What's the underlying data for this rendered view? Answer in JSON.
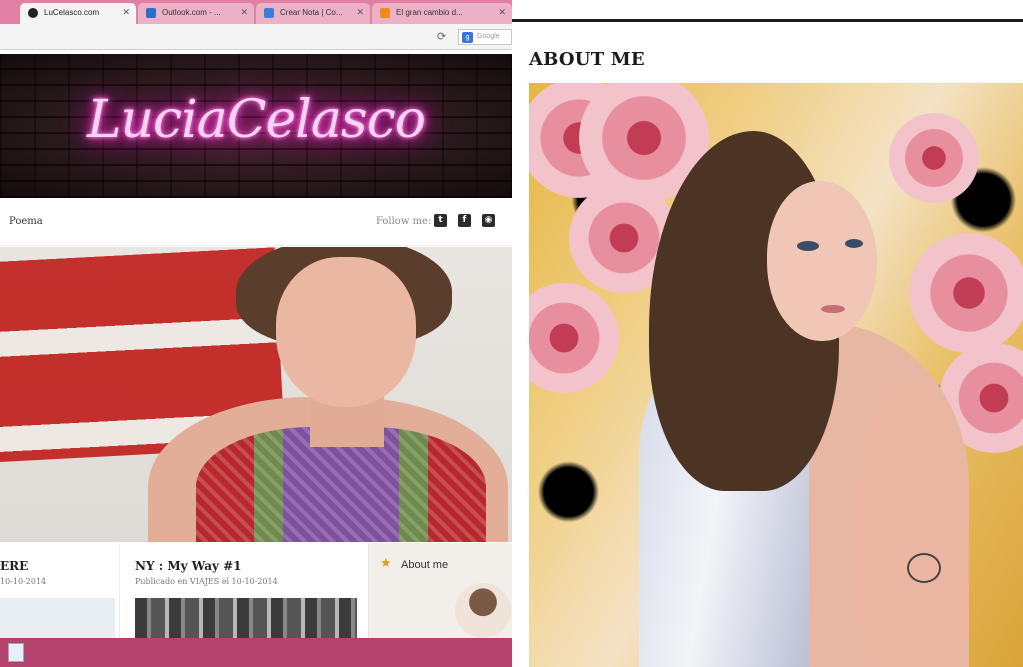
{
  "browser": {
    "tabs": [
      {
        "label": "LuCelasco.com",
        "active": true
      },
      {
        "label": "Outlook.com - ...",
        "active": false
      },
      {
        "label": "Crear Nota | Co...",
        "active": false
      },
      {
        "label": "El gran cambio d...",
        "active": false
      }
    ],
    "search_placeholder": "Google"
  },
  "site": {
    "logo_text": "LuciaCelasco",
    "nav": {
      "item": "Poema",
      "follow_label": "Follow me:"
    },
    "social_icons": [
      "instagram-icon",
      "facebook-icon",
      "tumblr-icon"
    ]
  },
  "posts": [
    {
      "title": "ERE",
      "date": "10-10-2014"
    },
    {
      "title": "NY : My Way #1",
      "meta": "Publicado en VIAJES el 10-10-2014"
    }
  ],
  "sidebar": {
    "about_label": "About me"
  },
  "right": {
    "heading": "ABOUT ME"
  },
  "colors": {
    "tab_bar": "#e27fa4",
    "taskbar": "#b5426c",
    "neon": "#ff4fd1",
    "accent_star": "#d6a21e"
  }
}
